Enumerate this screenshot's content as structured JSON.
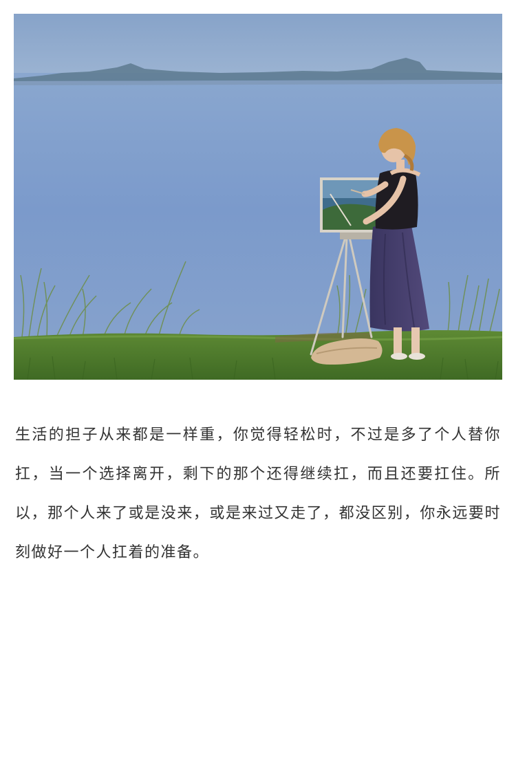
{
  "article": {
    "paragraph": "生活的担子从来都是一样重，你觉得轻松时，不过是多了个人替你扛，当一个选择离开，剩下的那个还得继续扛，而且还要扛住。所以，那个人来了或是没来，或是来过又走了，都没区别，你永远要时刻做好一个人扛着的准备。"
  },
  "colors": {
    "sky_top": "#8aa6c9",
    "water": "#7d9ccb",
    "grass": "#4d7a2c",
    "text": "#333333",
    "background": "#ffffff"
  }
}
